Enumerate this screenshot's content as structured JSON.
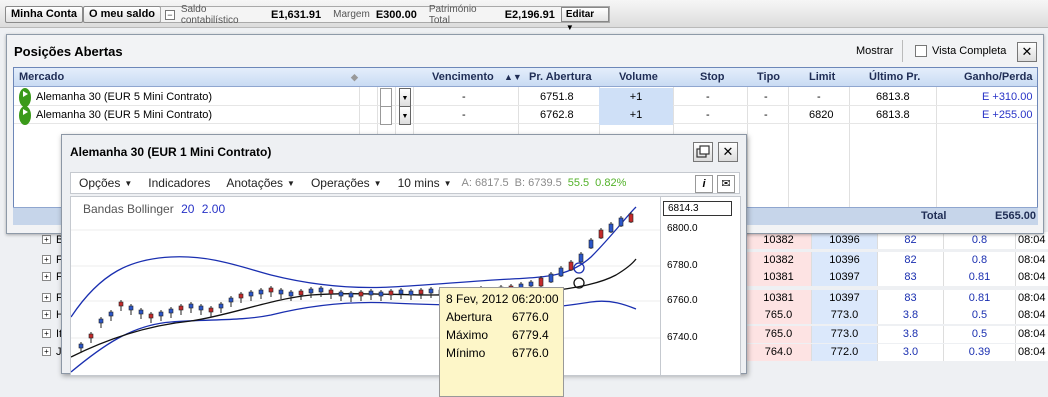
{
  "topbar": {
    "minha_conta": "Minha Conta",
    "meu_saldo": "O meu saldo",
    "minus": "−",
    "saldo_label": "Saldo contabilístico",
    "saldo_value": "E1,631.91",
    "margem_label": "Margem",
    "margem_value": "E300.00",
    "patrimonio_label": "Património Total",
    "patrimonio_value": "E2,196.91",
    "editar": "Editar"
  },
  "positions": {
    "title": "Posições Abertas",
    "mostrar": "Mostrar",
    "vista_completa": "Vista Completa",
    "close": "✕",
    "headers": {
      "mercado": "Mercado",
      "vencimento": "Vencimento",
      "pr_abertura": "Pr. Abertura",
      "volume": "Volume",
      "stop": "Stop",
      "tipo": "Tipo",
      "limit": "Limit",
      "ultimo": "Último Pr.",
      "ganho": "Ganho/Perda"
    },
    "rows": [
      {
        "mercado": "Alemanha 30 (EUR 5 Mini Contrato)",
        "vencimento": "-",
        "abertura": "6751.8",
        "volume": "+1",
        "stop": "-",
        "tipo": "-",
        "limit": "-",
        "ultimo": "6813.8",
        "ganho": "E +310.00"
      },
      {
        "mercado": "Alemanha 30 (EUR 5 Mini Contrato)",
        "vencimento": "-",
        "abertura": "6762.8",
        "volume": "+1",
        "stop": "-",
        "tipo": "-",
        "limit": "6820",
        "ultimo": "6813.8",
        "ganho": "E +255.00"
      }
    ],
    "total_label": "Total",
    "total_value": "E565.00"
  },
  "chart": {
    "title": "Alemanha 30 (EUR 1 Mini Contrato)",
    "close": "✕",
    "menus": {
      "opcoes": "Opções",
      "indicadores": "Indicadores",
      "anotacoes": "Anotações",
      "operacoes": "Operações",
      "intervalo": "10 mins"
    },
    "quote": {
      "ask": "A: 6817.5",
      "bid": "B: 6739.5",
      "change": "55.5",
      "change_pct": "0.82%"
    },
    "info_icon": "i",
    "mail_icon": "✉",
    "bollinger_label": "Bandas Bollinger",
    "bollinger_period": "20",
    "bollinger_dev": "2.00",
    "current_price": "6814.3",
    "axis_labels": [
      "6800.0",
      "6780.0",
      "6760.0",
      "6740.0"
    ],
    "tooltip": {
      "date": "8 Fev, 2012 06:20:00",
      "abertura_label": "Abertura",
      "abertura_value": "6776.0",
      "maximo_label": "Máximo",
      "maximo_value": "6779.4",
      "minimo_label": "Mínimo",
      "minimo_value": "6776.0"
    }
  },
  "background_rows": [
    {
      "letter": "B",
      "sell": "10382",
      "buy": "10396",
      "spread": "82",
      "pct": "0.8",
      "time": "08:04"
    },
    {
      "letter": "F",
      "sell": "10382",
      "buy": "10396",
      "spread": "82",
      "pct": "0.8",
      "time": "08:04"
    },
    {
      "letter": "F",
      "sell": "10381",
      "buy": "10397",
      "spread": "83",
      "pct": "0.81",
      "time": "08:04"
    },
    {
      "letter": "F",
      "sell": "10381",
      "buy": "10397",
      "spread": "83",
      "pct": "0.81",
      "time": "08:04"
    },
    {
      "letter": "H",
      "sell": "765.0",
      "buy": "773.0",
      "spread": "3.8",
      "pct": "0.5",
      "time": "08:04"
    },
    {
      "letter": "It",
      "sell": "765.0",
      "buy": "773.0",
      "spread": "3.8",
      "pct": "0.5",
      "time": "08:04"
    },
    {
      "letter": "J",
      "sell": "764.0",
      "buy": "772.0",
      "spread": "3.0",
      "pct": "0.39",
      "time": "08:04"
    }
  ],
  "colors": {
    "accent_blue": "#2833c7",
    "positive_green": "#53b22a",
    "sell_bg": "#fde3e3",
    "buy_bg": "#dbe8fb"
  }
}
